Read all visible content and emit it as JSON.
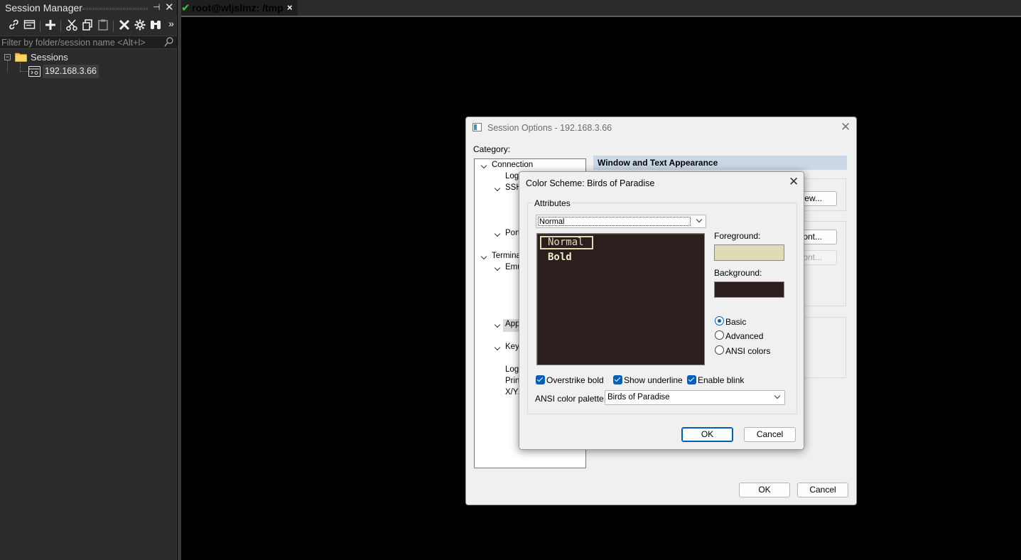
{
  "session_manager": {
    "title": "Session Manager",
    "filter_placeholder": "Filter by folder/session name <Alt+l>",
    "tree": {
      "root_label": "Sessions",
      "expander": "−",
      "session_label": "192.168.3.66"
    },
    "toolbar_more": "»"
  },
  "terminal": {
    "tab_label": "root@wljslmz: /tmp",
    "tab_close": "×"
  },
  "session_options": {
    "title": "Session Options - 192.168.3.66",
    "category_label": "Category:",
    "panel_heading": "Window and Text Appearance",
    "tree": [
      {
        "label": "Connection"
      },
      {
        "label": "Logo"
      },
      {
        "label": "SSH"
      },
      {
        "label": "Port"
      },
      {
        "label": "Termina"
      },
      {
        "label": "Emu"
      },
      {
        "label": "App"
      },
      {
        "label": "Keyb"
      },
      {
        "label": "Log"
      },
      {
        "label": "Print"
      },
      {
        "label": "X/Y/"
      }
    ],
    "partial_buttons": {
      "view": "iew...",
      "font": "ont...",
      "font2": "ont..."
    },
    "ok_label": "OK",
    "cancel_label": "Cancel"
  },
  "color_scheme": {
    "title": "Color Scheme: Birds of Paradise",
    "attributes_legend": "Attributes",
    "attribute_selected": "Normal",
    "preview": {
      "normal_text": "Normal",
      "bold_text": "Bold"
    },
    "foreground_label": "Foreground:",
    "background_label": "Background:",
    "foreground_color": "#e0dbb7",
    "background_color": "#2a1f1d",
    "radios": [
      {
        "label": "Basic",
        "selected": true
      },
      {
        "label": "Advanced",
        "selected": false
      },
      {
        "label": "ANSI colors",
        "selected": false
      }
    ],
    "checkboxes": [
      {
        "label": "Overstrike bold",
        "checked": true
      },
      {
        "label": "Show underline",
        "checked": true
      },
      {
        "label": "Enable blink",
        "checked": true
      }
    ],
    "palette_label": "ANSI color palette:",
    "palette_value": "Birds of Paradise",
    "ok_label": "OK",
    "cancel_label": "Cancel"
  }
}
